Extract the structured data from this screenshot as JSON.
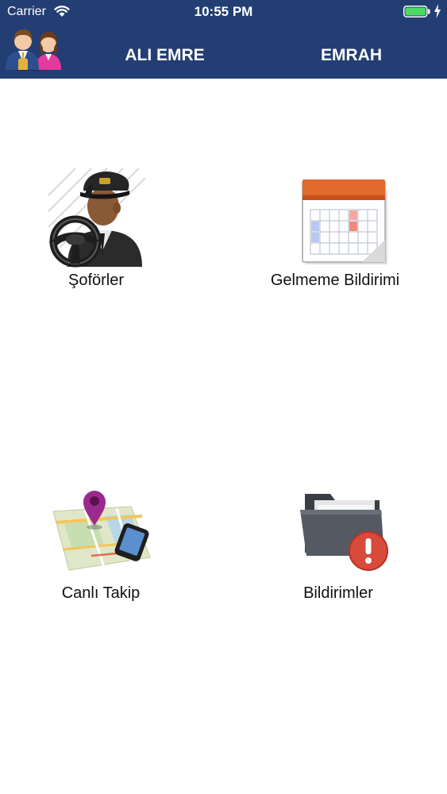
{
  "status_bar": {
    "carrier": "Carrier",
    "time": "10:55 PM",
    "wifi_icon": "wifi-icon",
    "battery_icon": "battery-icon",
    "battery_color": "#4cd964"
  },
  "header": {
    "background_color": "#233e72",
    "avatar_icon": "users-avatar-icon",
    "tabs": [
      {
        "label": "ALI EMRE"
      },
      {
        "label": "EMRAH"
      }
    ]
  },
  "menu": {
    "items": [
      {
        "label": "Şoförler",
        "icon": "driver-icon"
      },
      {
        "label": "Gelmeme Bildirimi",
        "icon": "calendar-icon"
      },
      {
        "label": "Canlı Takip",
        "icon": "map-tracking-icon"
      },
      {
        "label": "Bildirimler",
        "icon": "folder-alert-icon"
      }
    ]
  }
}
